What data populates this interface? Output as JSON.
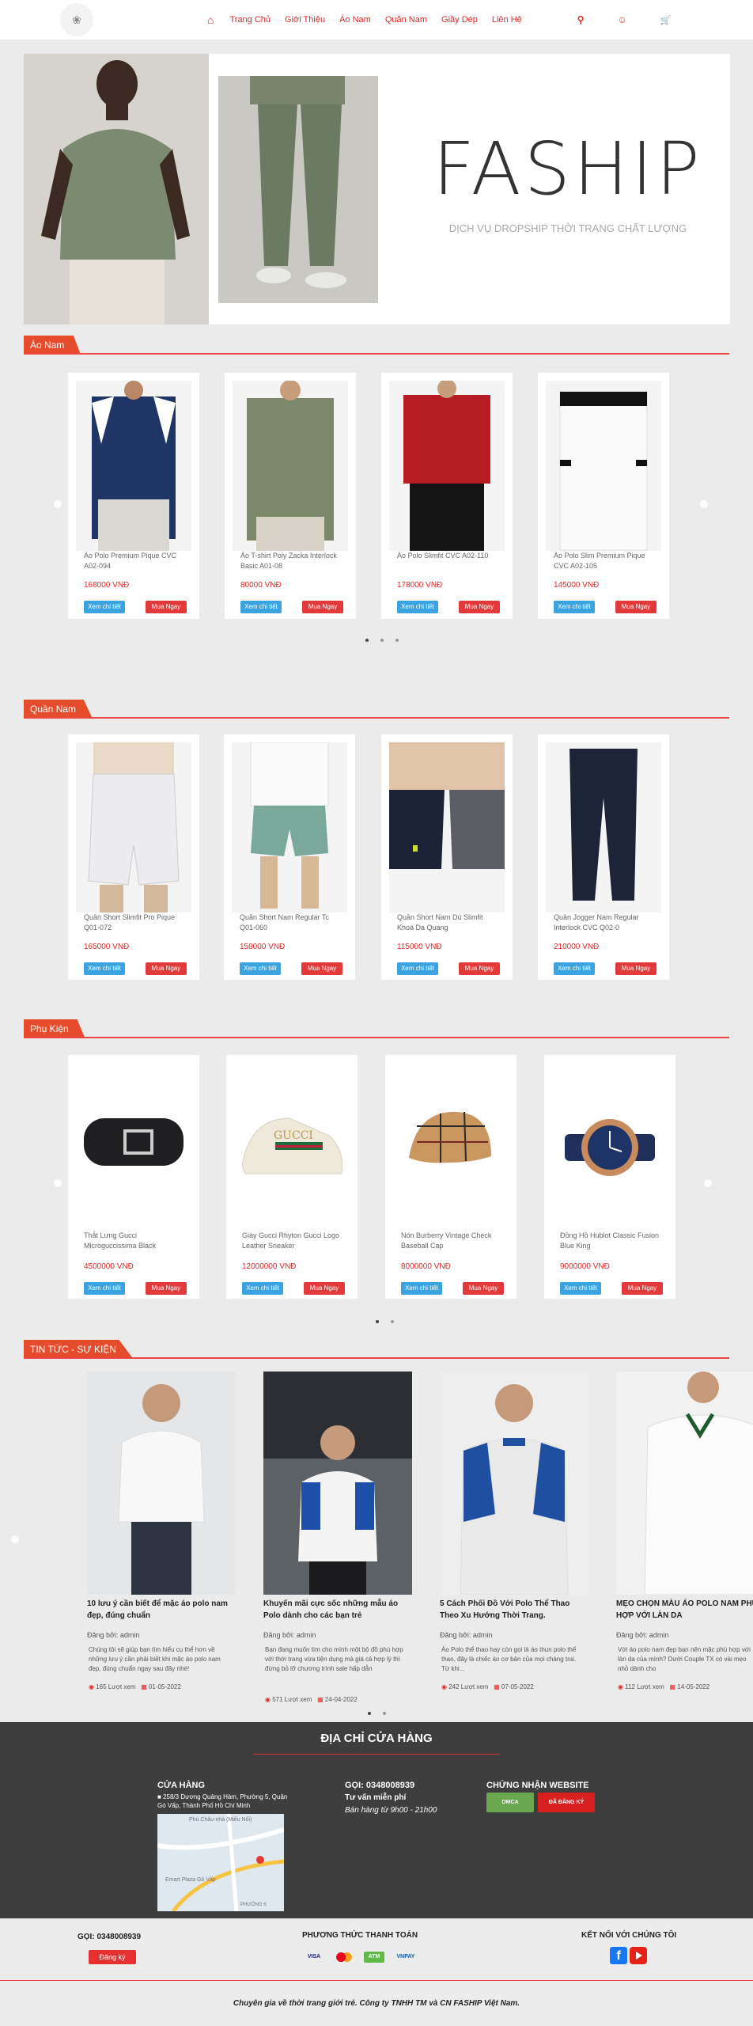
{
  "header": {
    "nav": [
      "Trang Chủ",
      "Giới Thiệu",
      "Áo Nam",
      "Quần Nam",
      "Giầy Dép",
      "Liên Hệ"
    ]
  },
  "banner": {
    "brand": "FASHIP",
    "tagline": "DỊCH VỤ DROPSHIP THỜI TRANG CHẤT LƯỢNG"
  },
  "sections": {
    "ao_nam": "Áo Nam",
    "quan_nam": "Quần Nam",
    "phu_kien": "Phụ Kiện",
    "tin_tuc": "TIN TỨC - SỰ KIỆN"
  },
  "buttons": {
    "view": "Xem chi tiết",
    "buy": "Mua Ngay"
  },
  "products_ao": [
    {
      "name": "Áo Polo Premium Pique CVC A02-094",
      "price": "168000 VNĐ"
    },
    {
      "name": "Áo T-shirt Poly Zacka Interlock Basic A01-08",
      "price": "80000 VNĐ"
    },
    {
      "name": "Áo Polo Slimfit CVC A02-110",
      "price": "178000 VNĐ"
    },
    {
      "name": "Áo Polo Slim Premium Pique CVC A02-105",
      "price": "145000 VNĐ"
    }
  ],
  "products_quan": [
    {
      "name": "Quần Short Slimfit Pro Pique Q01-072",
      "price": "165000 VNĐ"
    },
    {
      "name": "Quần Short Nam Regular Tc Q01-060",
      "price": "158000 VNĐ"
    },
    {
      "name": "Quần Short Nam Dù Slimfit Khoá Da Quang",
      "price": "115000 VNĐ"
    },
    {
      "name": "Quần Jogger Nam Regular Interlock CVC Q02-0",
      "price": "210000 VNĐ"
    }
  ],
  "products_pk": [
    {
      "name": "Thắt Lưng Gucci Microguccissima Black",
      "price": "4500000 VNĐ"
    },
    {
      "name": "Giày Gucci Rhyton Gucci Logo Leather Sneaker",
      "price": "12000000 VNĐ"
    },
    {
      "name": "Nón Burberry Vintage Check Baseball Cap",
      "price": "8000000 VNĐ"
    },
    {
      "name": "Đồng Hồ Hublot Classic Fusion Blue King",
      "price": "9000000 VNĐ"
    }
  ],
  "news": [
    {
      "title": "10 lưu ý cần biết để mặc áo polo nam đẹp, đúng chuẩn",
      "author": "Đăng bởi: admin",
      "desc": "Chúng tôi sẽ giúp bạn tìm hiểu cụ thể hơn về những lưu ý cần phải biết khi mặc áo polo nam đẹp, đúng chuẩn ngay sau đây nhé!",
      "views": "165 Lượt xem",
      "date": "01-05-2022"
    },
    {
      "title": "Khuyến mãi cực sốc những mẫu áo Polo dành cho các bạn trẻ",
      "author": "Đăng bởi: admin",
      "desc": "Bạn đang muốn tìm cho mình một bộ đồ phù hợp với thời trang vừa tiện dụng mà giá cả hợp lý thì đừng bỏ lỡ chương trình sale hấp dẫn",
      "views": "571 Lượt xem",
      "date": "24-04-2022"
    },
    {
      "title": "5 Cách Phối Đồ Với Polo Thể Thao Theo Xu Hướng Thời Trang.",
      "author": "Đăng bởi: admin",
      "desc": "Áo Polo thể thao hay còn gọi là áo thun polo thể thao, đây là chiếc áo cơ bản của mọi chàng trai. Từ khi...",
      "views": "242 Lượt xem",
      "date": "07-05-2022"
    },
    {
      "title": "MẸO CHỌN MÀU ÁO POLO NAM PHÙ HỢP VỚI LÀN DA",
      "author": "Đăng bởi: admin",
      "desc": "Với áo polo nam đẹp bạn nên mặc phù hợp với làn da của mình? Dưới Couple TX có vài mẹo nhỏ dành cho",
      "views": "112 Lượt xem",
      "date": "14-05-2022"
    }
  ],
  "store": {
    "title": "ĐỊA CHỈ CỬA HÀNG",
    "shop_head": "CỬA HÀNG",
    "address": "258/3 Dương Quảng Hàm, Phường 5, Quận Gò Vấp, Thành Phố Hồ Chí Minh",
    "phone_head": "GỌI: 0348008939",
    "advice": "Tư vấn miễn phí",
    "hours": "Bán hàng từ 9h00 - 21h00",
    "cert_head": "CHỨNG NHẬN WEBSITE",
    "badge1": "DMCA",
    "badge2": "ĐÃ ĐĂNG KÝ",
    "map_labels": [
      "Phú Châu-nhà (Miếu Nổi)",
      "Emart Plaza Gò Vấp",
      "PHƯỜNG 6"
    ]
  },
  "footer": {
    "phone": "GỌI: 0348008939",
    "register": "Đăng ký",
    "pay_head": "PHƯƠNG THỨC THANH TOÁN",
    "pay": [
      "VISA",
      "MC",
      "ATM",
      "VNPAY"
    ],
    "social_head": "KẾT NỐI VỚI CHÚNG TÔI",
    "copyright": "Chuyên gia về thời trang giới trẻ. Công ty TNHH TM và CN FASHIP Việt Nam."
  }
}
